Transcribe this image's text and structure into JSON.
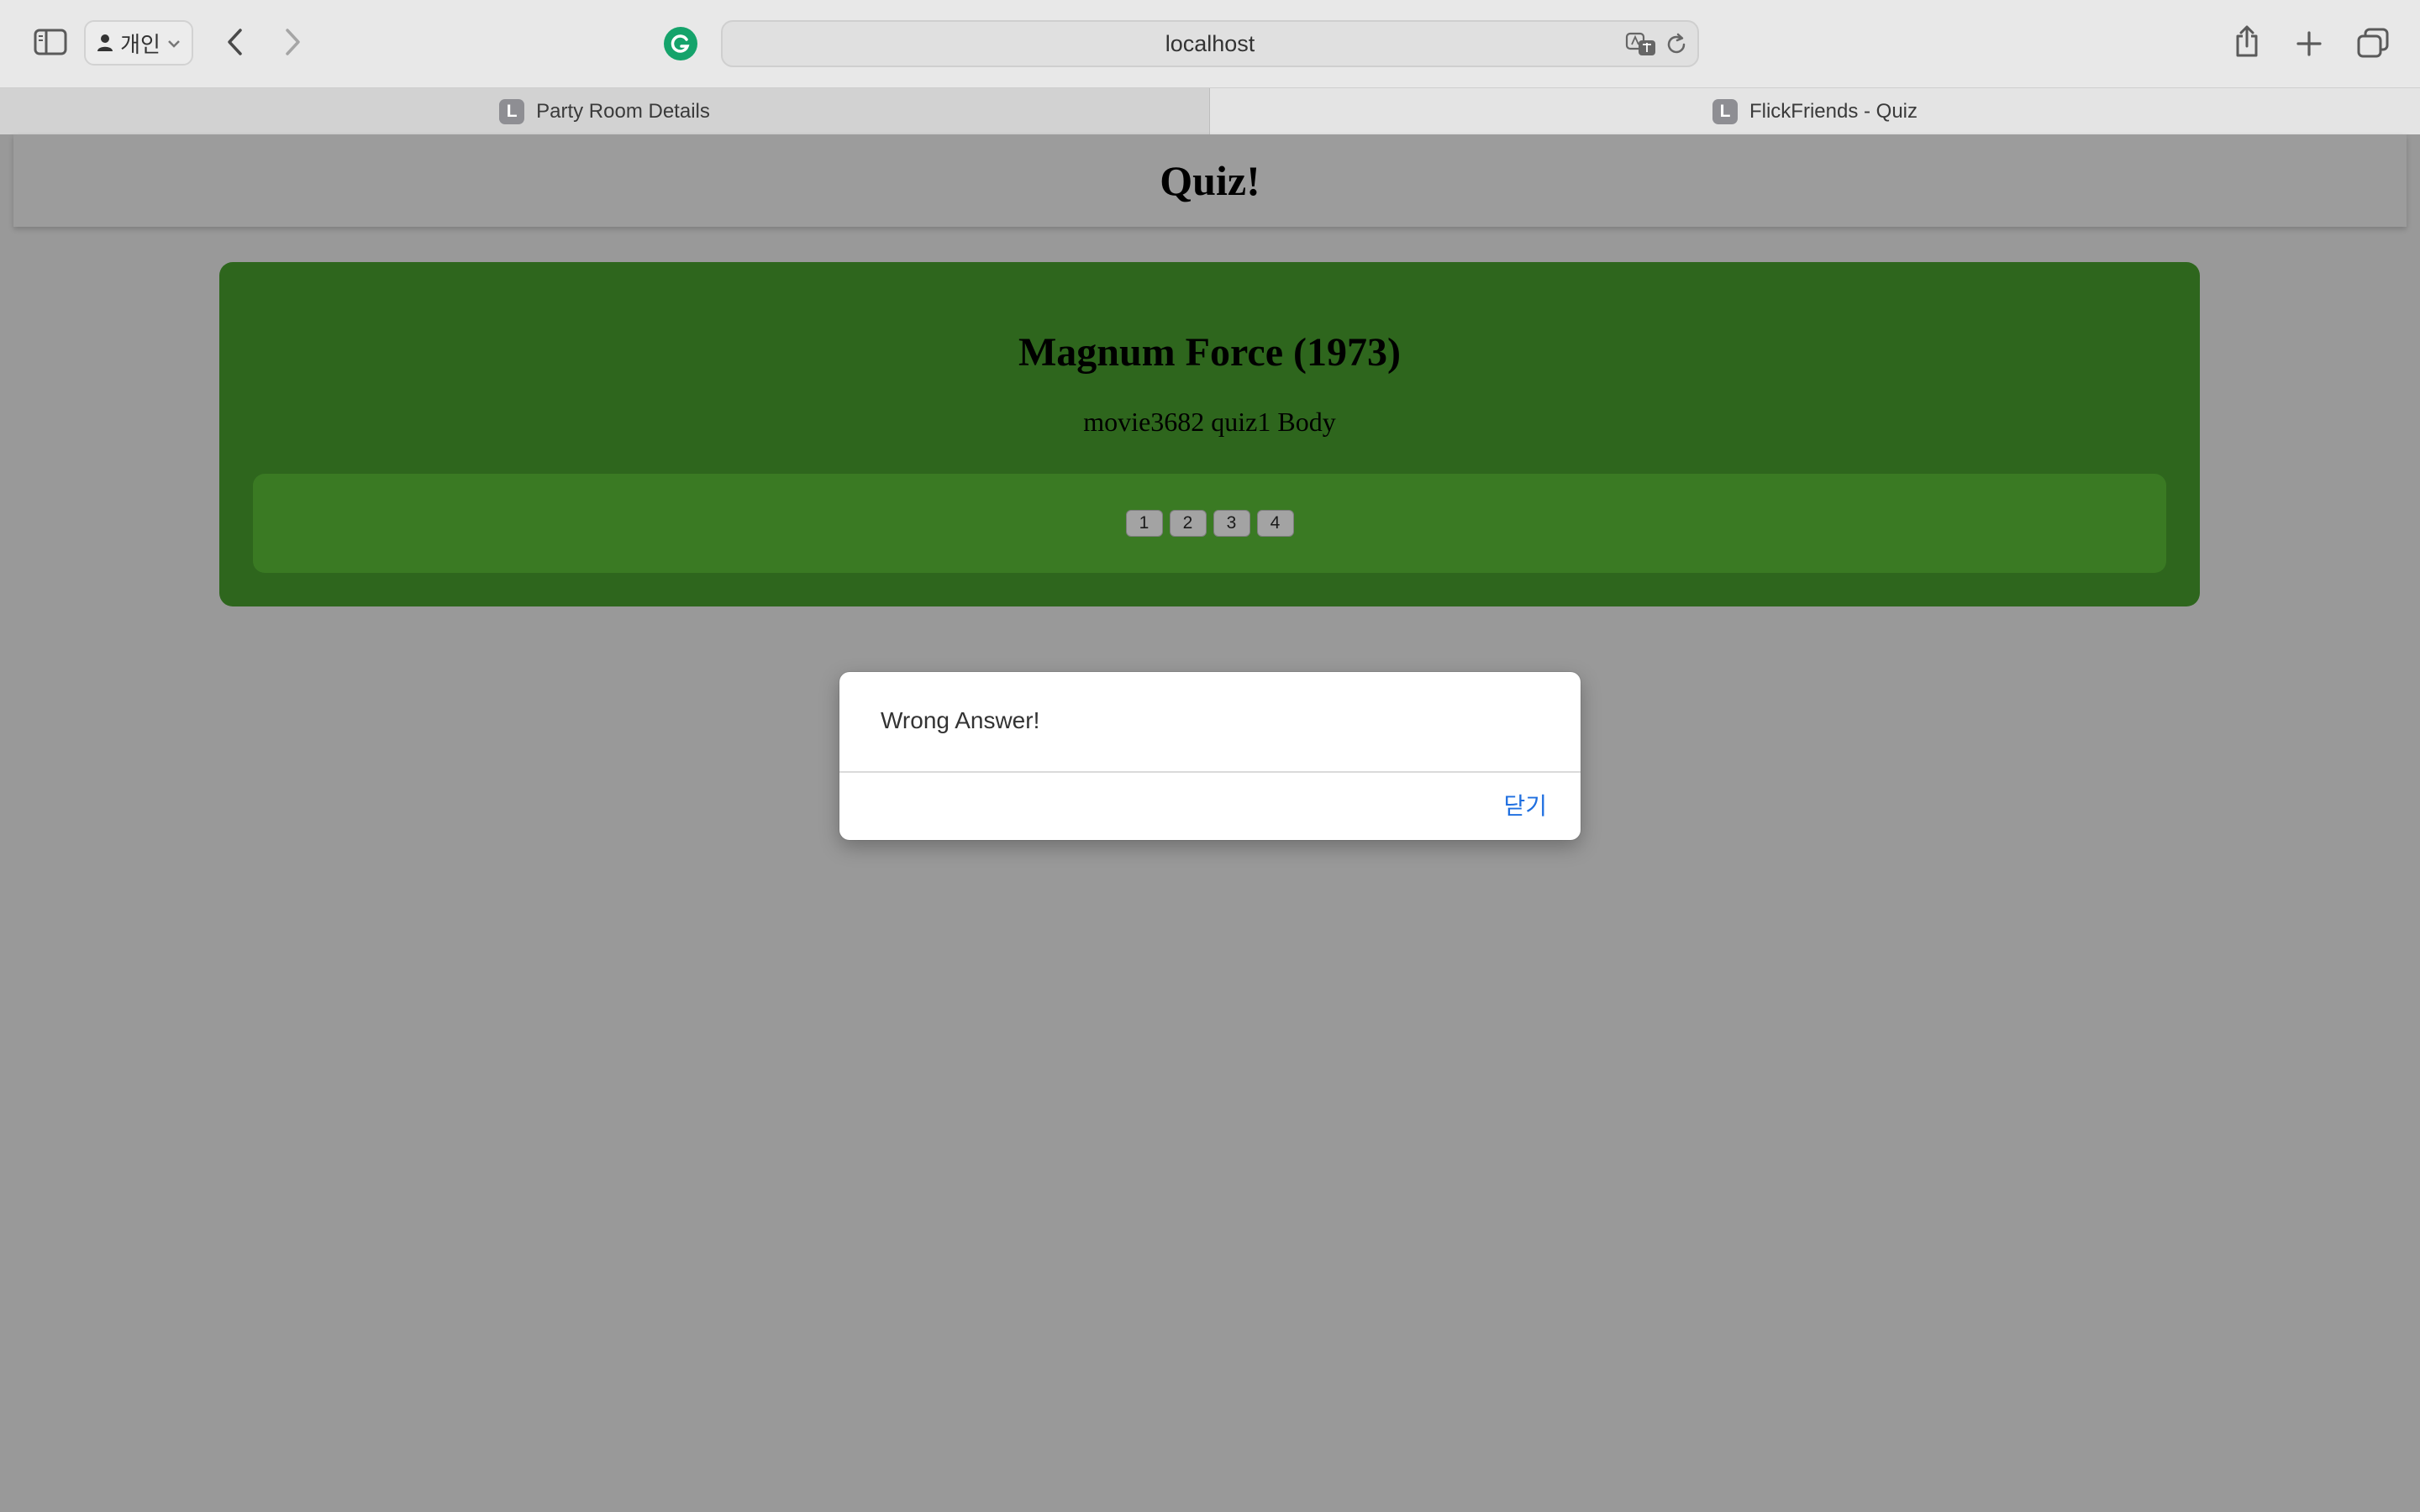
{
  "browser": {
    "profile_label": "개인",
    "url": "localhost",
    "tabs": [
      {
        "favicon_letter": "L",
        "title": "Party Room Details",
        "active": false
      },
      {
        "favicon_letter": "L",
        "title": "FlickFriends - Quiz",
        "active": true
      }
    ],
    "colors": {
      "toolbar_bg": "#e8e8e8",
      "grammarly": "#15a36b"
    }
  },
  "page": {
    "title": "Quiz!",
    "quiz": {
      "movie_title": "Magnum Force (1973)",
      "body": "movie3682 quiz1 Body",
      "answers": [
        "1",
        "2",
        "3",
        "4"
      ]
    },
    "colors": {
      "background": "#999999",
      "card": "#2e661d",
      "answers_panel": "#3a7a23"
    }
  },
  "alert": {
    "message": "Wrong Answer!",
    "close_label": "닫기",
    "accent": "#1f6fe0"
  }
}
